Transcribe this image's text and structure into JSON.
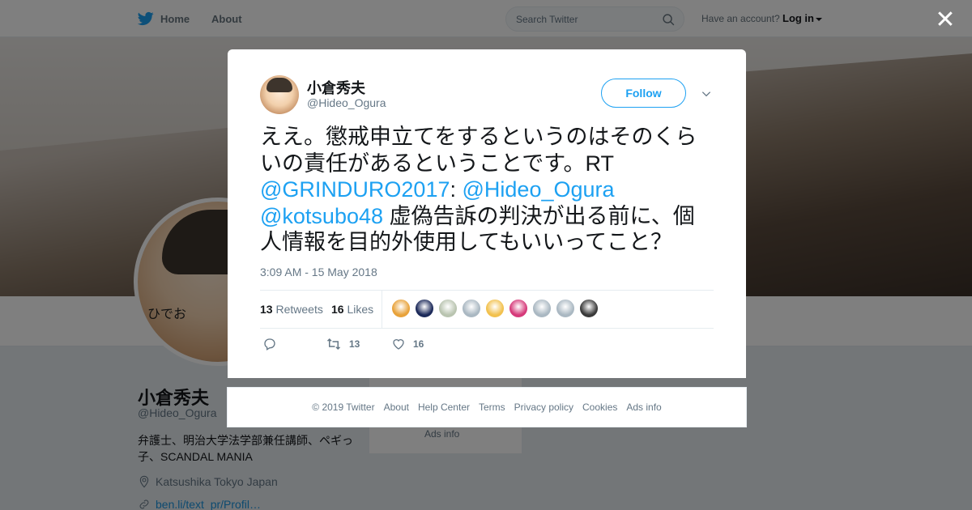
{
  "nav": {
    "home_label": "Home",
    "about_label": "About",
    "search_placeholder": "Search Twitter",
    "have_account": "Have an account?",
    "login_label": "Log in"
  },
  "profile": {
    "name": "小倉秀夫",
    "handle": "@Hideo_Ogura",
    "bio": "弁護士、明治大学法学部兼任講師、ペギっ子、SCANDAL MANIA",
    "location": "Katsushika Tokyo Japan",
    "link": "ben.li/text_pr/Profil…",
    "avatar_caption": "ひでお",
    "sidebar_ads": "Ads info"
  },
  "tweet": {
    "author_name": "小倉秀夫",
    "author_handle": "@Hideo_Ogura",
    "follow_label": "Follow",
    "text_part1": "ええ。懲戒申立てをするというのはそのくらいの責任があるということです。RT ",
    "mention1": "@GRINDURO2017",
    "sep": ": ",
    "mention2": "@Hideo_Ogura",
    "mention3": "@kotsubo48",
    "text_part2": " 虚偽告訴の判決が出る前に、個人情報を目的外使用してもいいってこと？",
    "timestamp": "3:09 AM - 15 May 2018",
    "retweets_count": "13",
    "retweets_label": "Retweets",
    "likes_count": "16",
    "likes_label": "Likes",
    "action_retweet_count": "13",
    "action_like_count": "16",
    "liker_colors": [
      "#e8a23a",
      "#1c2a5a",
      "#b9c4b0",
      "#aab8c2",
      "#f2c14e",
      "#d63a7a",
      "#aab8c2",
      "#aab8c2",
      "#3a3a3a"
    ]
  },
  "footer": {
    "links": [
      "© 2019 Twitter",
      "About",
      "Help Center",
      "Terms",
      "Privacy policy",
      "Cookies",
      "Ads info"
    ]
  },
  "colors": {
    "accent": "#1da1f2",
    "text_secondary": "#657786"
  }
}
